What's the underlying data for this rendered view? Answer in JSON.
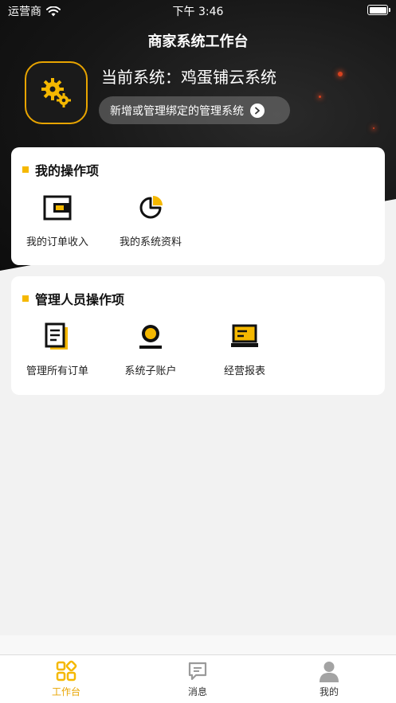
{
  "status_bar": {
    "carrier": "运营商",
    "time": "下午 3:46"
  },
  "header": {
    "title": "商家系统工作台"
  },
  "system": {
    "current_label": "当前系统：鸡蛋铺云系统",
    "manage_button": "新增或管理绑定的管理系统",
    "logo_icon": "gears-icon"
  },
  "my_ops": {
    "title": "我的操作项",
    "items": [
      {
        "label": "我的订单收入",
        "icon": "wallet-icon"
      },
      {
        "label": "我的系统资料",
        "icon": "pie-chart-icon"
      }
    ]
  },
  "admin_ops": {
    "title": "管理人员操作项",
    "items": [
      {
        "label": "管理所有订单",
        "icon": "document-icon"
      },
      {
        "label": "系统子账户",
        "icon": "user-account-icon"
      },
      {
        "label": "经营报表",
        "icon": "laptop-report-icon"
      }
    ]
  },
  "tabbar": {
    "tabs": [
      {
        "label": "工作台",
        "icon": "grid-icon",
        "active": true
      },
      {
        "label": "消息",
        "icon": "message-icon",
        "active": false
      },
      {
        "label": "我的",
        "icon": "person-icon",
        "active": false
      }
    ]
  },
  "colors": {
    "accent": "#f5b800",
    "tab_active": "#e8a400",
    "dark_bg": "#161616"
  }
}
